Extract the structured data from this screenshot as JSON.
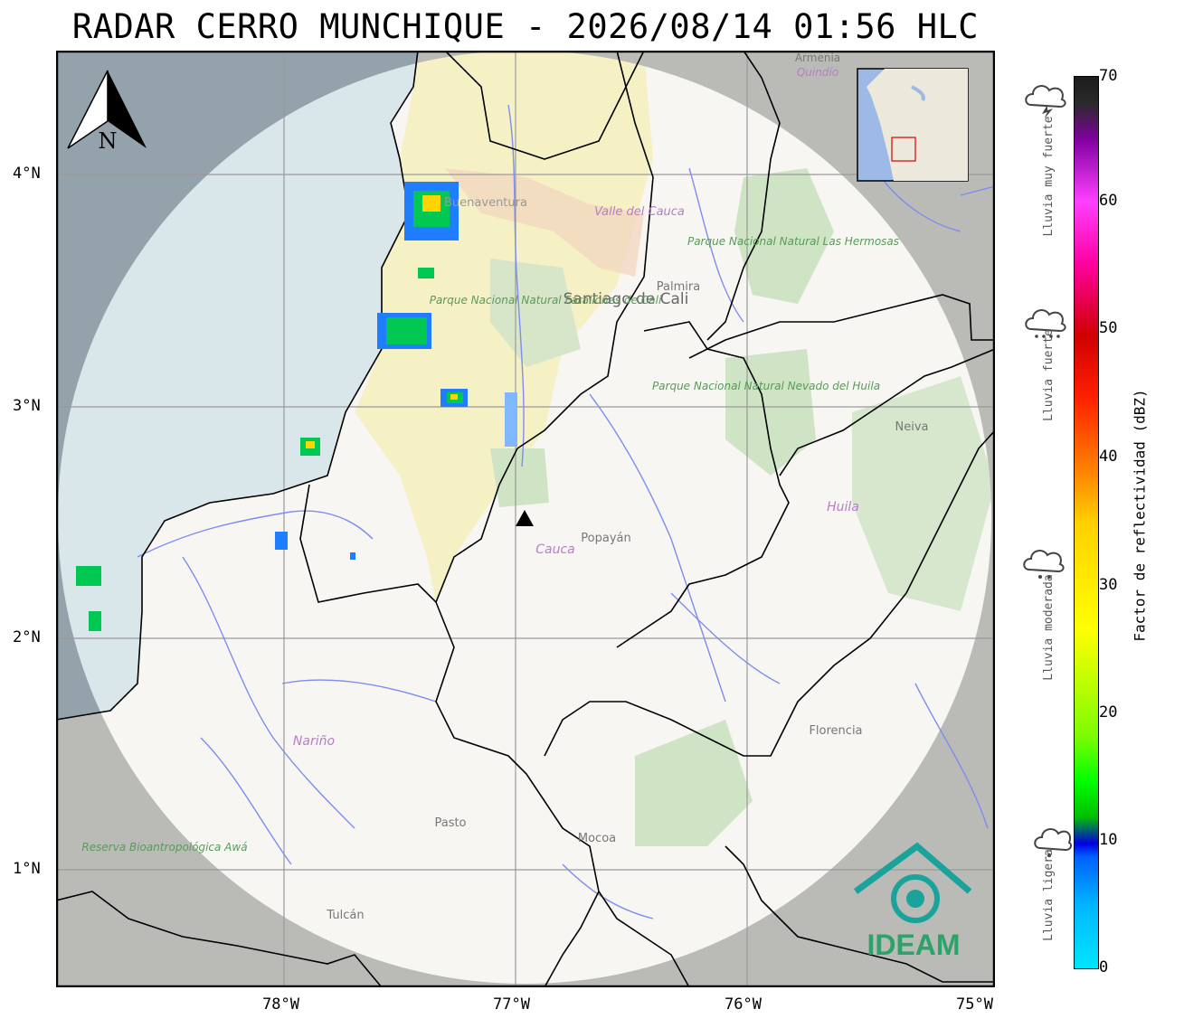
{
  "title": "RADAR CERRO MUNCHIQUE - 2026/08/14 01:56 HLC",
  "map": {
    "lat_ticks": [
      "4°N",
      "3°N",
      "2°N",
      "1°N"
    ],
    "lon_ticks": [
      "78°W",
      "77°W",
      "76°W",
      "75°W"
    ],
    "north_arrow_label": "N",
    "place_labels": {
      "santiago": "Santiago de Cali",
      "palmira": "Palmira",
      "popayan": "Popayán",
      "cauca": "Cauca",
      "huila": "Huila",
      "neiva": "Neiva",
      "narino": "Nariño",
      "pasto": "Pasto",
      "mocoa": "Mocoa",
      "florencia": "Florencia",
      "tulcan": "Tulcán",
      "valle": "Valle del Cauca",
      "buenaventura": "Buenaventura",
      "armenia": "Armenia",
      "quindio": "Quindío",
      "pnn_hermosas": "Parque Nacional Natural Las Hermosas",
      "pnn_farallones": "Parque Nacional Natural Farallones de Cali",
      "pnn_huila": "Parque Nacional Natural Nevado del Huila",
      "reserva_awa": "Reserva Bioantropológica Awá"
    },
    "logo_text": "IDEAM"
  },
  "colorbar": {
    "label": "Factor de reflectividad (dBZ)",
    "ticks": [
      "70",
      "60",
      "50",
      "40",
      "30",
      "20",
      "10",
      "0"
    ]
  },
  "rain_categories": [
    "Lluvia muy fuerte",
    "Lluvia fuerte",
    "Lluvia moderada",
    "Lluvia ligera"
  ],
  "colors": {
    "ocean": "#a9c4d4",
    "land": "#f5f4f1",
    "outside_range": "#bfbfbf",
    "valle_del_cauca": "#f7f3c9",
    "radar_marker": "#000000"
  }
}
